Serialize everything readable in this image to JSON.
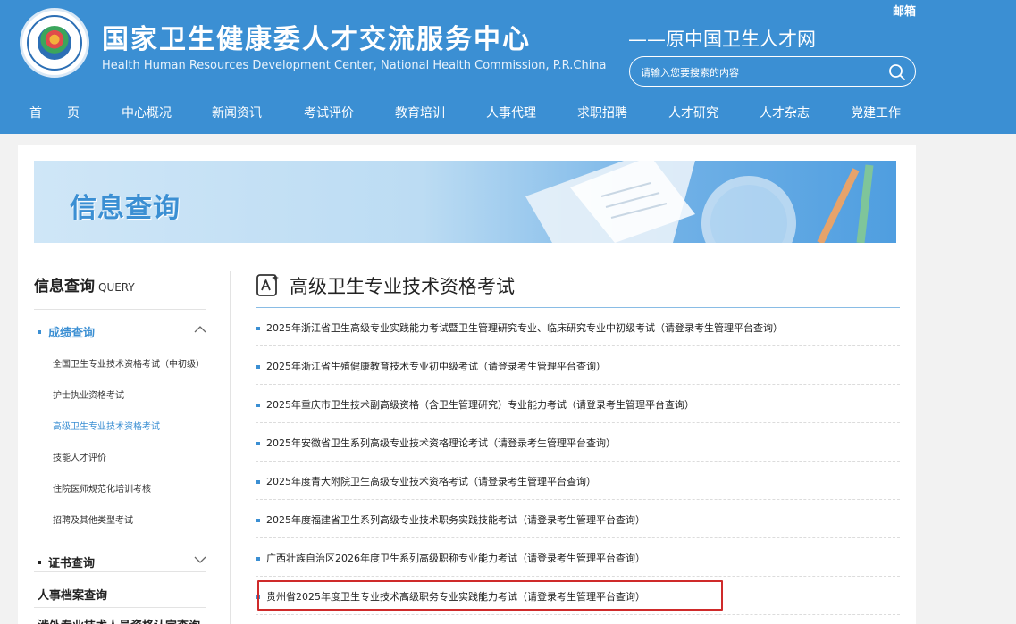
{
  "header": {
    "title": "国家卫生健康委人才交流服务中心",
    "subtitle": "Health Human Resources Development Center, National Health Commission, P.R.China",
    "former_name": "——原中国卫生人才网",
    "mail_label": "邮箱",
    "search_placeholder": "请输入您要搜索的内容",
    "brand_color": "#3b8fd3"
  },
  "nav": {
    "items": [
      "首　　页",
      "中心概况",
      "新闻资讯",
      "考试评价",
      "教育培训",
      "人事代理",
      "求职招聘",
      "人才研究",
      "人才杂志",
      "党建工作"
    ]
  },
  "banner": {
    "title": "信息查询"
  },
  "sidebar": {
    "title": "信息查询",
    "title_en": "QUERY",
    "group_results": "成绩查询",
    "sub_items": [
      "全国卫生专业技术资格考试（中初级）",
      "护士执业资格考试",
      "高级卫生专业技术资格考试",
      "技能人才评价",
      "住院医师规范化培训考核",
      "招聘及其他类型考试"
    ],
    "active_sub_index": 2,
    "group_certificate": "证书查询",
    "group_personnel": "人事档案查询",
    "group_foreign": "涉外专业技术人员资格认定查询"
  },
  "content": {
    "title": "高级卫生专业技术资格考试",
    "items": [
      "2025年浙江省卫生高级专业实践能力考试暨卫生管理研究专业、临床研究专业中初级考试（请登录考生管理平台查询）",
      "2025年浙江省生殖健康教育技术专业初中级考试（请登录考生管理平台查询）",
      "2025年重庆市卫生技术副高级资格（含卫生管理研究）专业能力考试（请登录考生管理平台查询）",
      "2025年安徽省卫生系列高级专业技术资格理论考试（请登录考生管理平台查询）",
      "2025年度青大附院卫生高级专业技术资格考试（请登录考生管理平台查询）",
      "2025年度福建省卫生系列高级专业技术职务实践技能考试（请登录考生管理平台查询）",
      "广西壮族自治区2026年度卫生系列高级职称专业能力考试（请登录考生管理平台查询）",
      "贵州省2025年度卫生专业技术高级职务专业实践能力考试（请登录考生管理平台查询）"
    ],
    "highlighted_index": 7,
    "highlight_color": "#cf2a2a"
  }
}
